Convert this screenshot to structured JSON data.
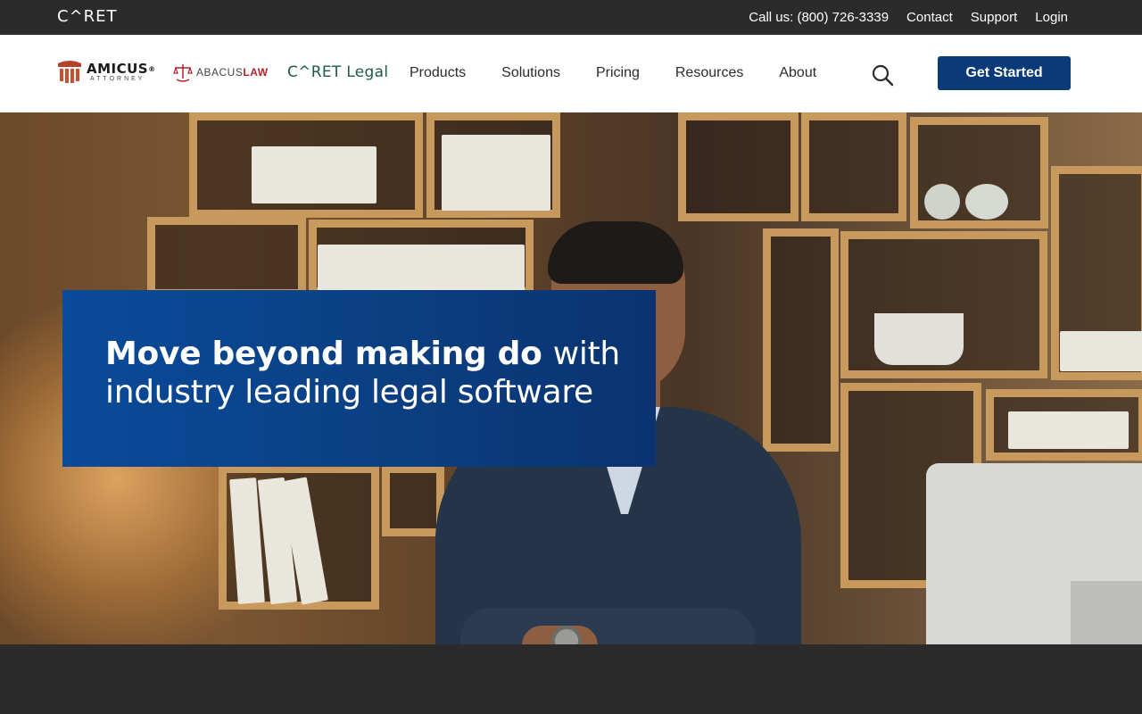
{
  "topbar": {
    "logo": "C^RET",
    "phone": "Call us: (800) 726-3339",
    "links": [
      "Contact",
      "Support",
      "Login"
    ]
  },
  "brands": {
    "amicus": {
      "name": "AMICUS",
      "sub": "ATTORNEY",
      "mark": "®"
    },
    "abacus": {
      "prefix": "ABACUS",
      "suffix": "LAW"
    },
    "caret_legal": {
      "caret": "C^RET",
      "legal": "Legal"
    }
  },
  "nav": {
    "items": [
      "Products",
      "Solutions",
      "Pricing",
      "Resources",
      "About"
    ],
    "search_icon": "search-icon",
    "cta_label": "Get Started"
  },
  "hero": {
    "headline_bold": "Move beyond making do",
    "headline_regular": "with industry leading legal software"
  },
  "colors": {
    "topbar_bg": "#2b2b2b",
    "nav_bg": "#ffffff",
    "brand_blue": "#0b3a7a",
    "hero_card": "#0a4b9a",
    "caret_green": "#1f5a4a",
    "abacus_red": "#b5212b"
  }
}
